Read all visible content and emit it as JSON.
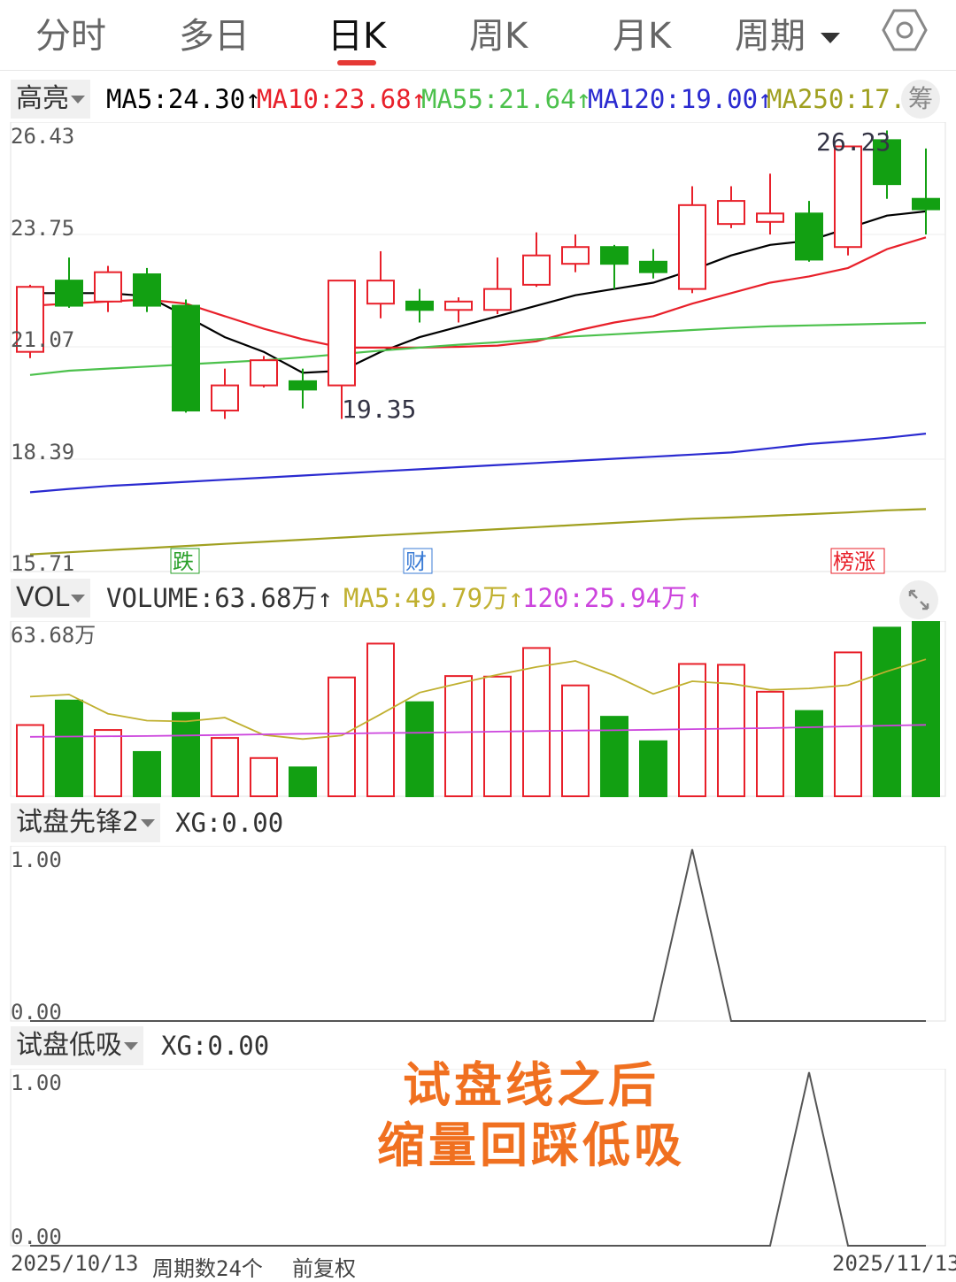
{
  "tabs": [
    {
      "label": "分时",
      "active": false
    },
    {
      "label": "多日",
      "active": false
    },
    {
      "label": "日K",
      "active": true
    },
    {
      "label": "周K",
      "active": false
    },
    {
      "label": "月K",
      "active": false
    },
    {
      "label": "周期",
      "active": false,
      "dropdown": true
    }
  ],
  "colors": {
    "up": "#e8202a",
    "down": "#12a012",
    "ma5": "#000000",
    "ma10": "#e8202a",
    "ma55": "#4cc14c",
    "ma120": "#2a2ad0",
    "ma250": "#a0a020",
    "vol_ma5": "#c0b030",
    "vol_ma120": "#cc44dd",
    "overlay": "#f07020"
  },
  "kline": {
    "selector": "高亮",
    "legend": {
      "ma5": "MA5:24.30↑",
      "ma10": "MA10:23.68↑",
      "ma55": "MA55:21.64↑",
      "ma120": "MA120:19.00↑",
      "ma250": "MA250:17."
    },
    "chip_button": "筹",
    "y_ticks": [
      "26.43",
      "23.75",
      "21.07",
      "18.39",
      "15.71"
    ],
    "high_label": "26.23",
    "low_label": "19.35",
    "tags": [
      "跌",
      "财",
      "榜涨"
    ]
  },
  "volume": {
    "selector": "VOL",
    "legend": {
      "volume": "VOLUME:63.68万↑",
      "ma5": "MA5:49.79万↑",
      "ma120": "120:25.94万↑"
    },
    "max_label": "63.68万"
  },
  "ind1": {
    "selector": "试盘先锋2",
    "value": "XG:0.00",
    "y_top": "1.00",
    "y_bottom": "0.00"
  },
  "ind2": {
    "selector": "试盘低吸",
    "value": "XG:0.00",
    "y_top": "1.00",
    "y_bottom": "0.00"
  },
  "overlay_text": {
    "line1": "试盘线之后",
    "line2": "缩量回踩低吸"
  },
  "footer": {
    "start_date": "2025/10/13",
    "periods": "周期数24个",
    "adjust": "前复权",
    "end_date": "2025/11/13"
  },
  "chart_data": [
    {
      "type": "candlestick",
      "title": "日K",
      "ylim": [
        15.71,
        26.43
      ],
      "candles": [
        {
          "open": 20.95,
          "close": 22.5,
          "high": 22.55,
          "low": 20.8
        },
        {
          "open": 22.65,
          "close": 22.05,
          "high": 23.2,
          "low": 22.0
        },
        {
          "open": 22.15,
          "close": 22.85,
          "high": 23.0,
          "low": 21.9
        },
        {
          "open": 22.8,
          "close": 22.05,
          "high": 22.95,
          "low": 21.9
        },
        {
          "open": 22.05,
          "close": 19.55,
          "high": 22.2,
          "low": 19.5
        },
        {
          "open": 19.55,
          "close": 20.15,
          "high": 20.55,
          "low": 19.35
        },
        {
          "open": 20.15,
          "close": 20.75,
          "high": 20.85,
          "low": 20.1
        },
        {
          "open": 20.25,
          "close": 20.05,
          "high": 20.55,
          "low": 19.6
        },
        {
          "open": 20.15,
          "close": 22.65,
          "high": 22.65,
          "low": 19.35
        },
        {
          "open": 22.1,
          "close": 22.65,
          "high": 23.35,
          "low": 21.75
        },
        {
          "open": 22.15,
          "close": 21.95,
          "high": 22.45,
          "low": 21.65
        },
        {
          "open": 21.95,
          "close": 22.15,
          "high": 22.25,
          "low": 21.65
        },
        {
          "open": 21.95,
          "close": 22.45,
          "high": 23.2,
          "low": 21.85
        },
        {
          "open": 22.55,
          "close": 23.25,
          "high": 23.8,
          "low": 22.5
        },
        {
          "open": 23.05,
          "close": 23.45,
          "high": 23.75,
          "low": 22.85
        },
        {
          "open": 23.45,
          "close": 23.05,
          "high": 23.5,
          "low": 22.45
        },
        {
          "open": 23.1,
          "close": 22.85,
          "high": 23.4,
          "low": 22.7
        },
        {
          "open": 22.45,
          "close": 24.45,
          "high": 24.9,
          "low": 22.35
        },
        {
          "open": 24.0,
          "close": 24.55,
          "high": 24.9,
          "low": 23.9
        },
        {
          "open": 24.05,
          "close": 24.25,
          "high": 25.2,
          "low": 23.75
        },
        {
          "open": 24.25,
          "close": 23.15,
          "high": 24.55,
          "low": 23.1
        },
        {
          "open": 23.45,
          "close": 25.85,
          "high": 25.85,
          "low": 23.25
        },
        {
          "open": 26.0,
          "close": 24.95,
          "high": 26.23,
          "low": 24.6
        },
        {
          "open": 24.6,
          "close": 24.35,
          "high": 25.8,
          "low": 23.75
        }
      ],
      "ma_lines": [
        {
          "name": "MA5",
          "values": [
            22.35,
            22.35,
            22.35,
            22.28,
            21.8,
            21.3,
            20.95,
            20.45,
            20.5,
            20.95,
            21.3,
            21.55,
            21.8,
            22.05,
            22.3,
            22.45,
            22.6,
            22.9,
            23.25,
            23.5,
            23.6,
            23.9,
            24.2,
            24.3
          ]
        },
        {
          "name": "MA10",
          "values": [
            22.05,
            22.1,
            22.15,
            22.2,
            22.1,
            21.8,
            21.5,
            21.25,
            21.05,
            21.05,
            21.05,
            21.07,
            21.1,
            21.2,
            21.45,
            21.65,
            21.8,
            22.1,
            22.35,
            22.6,
            22.75,
            22.95,
            23.4,
            23.68
          ]
        },
        {
          "name": "MA55",
          "values": [
            20.4,
            20.5,
            20.55,
            20.6,
            20.65,
            20.7,
            20.75,
            20.82,
            20.9,
            20.98,
            21.05,
            21.12,
            21.18,
            21.25,
            21.32,
            21.37,
            21.42,
            21.47,
            21.52,
            21.56,
            21.58,
            21.6,
            21.62,
            21.64
          ]
        },
        {
          "name": "MA120",
          "values": [
            17.6,
            17.68,
            17.75,
            17.8,
            17.85,
            17.9,
            17.95,
            18.0,
            18.05,
            18.1,
            18.15,
            18.2,
            18.25,
            18.3,
            18.35,
            18.4,
            18.45,
            18.5,
            18.55,
            18.65,
            18.75,
            18.82,
            18.9,
            19.0
          ]
        },
        {
          "name": "MA250",
          "values": [
            16.12,
            16.17,
            16.22,
            16.27,
            16.32,
            16.37,
            16.42,
            16.47,
            16.52,
            16.57,
            16.62,
            16.67,
            16.72,
            16.77,
            16.82,
            16.87,
            16.92,
            16.97,
            17.0,
            17.04,
            17.08,
            17.12,
            17.17,
            17.2
          ]
        }
      ],
      "annotations": [
        {
          "text": "26.23",
          "value": 26.23
        },
        {
          "text": "19.35",
          "value": 19.35
        }
      ]
    },
    {
      "type": "bar",
      "title": "VOL",
      "ylim": [
        0,
        63.68
      ],
      "values": [
        25.9,
        34.8,
        24.1,
        16.1,
        30.3,
        21.2,
        13.9,
        10.5,
        43.2,
        55.5,
        34.2,
        43.7,
        43.5,
        53.9,
        40.3,
        28.9,
        20.0,
        48.1,
        47.8,
        38.0,
        31.0,
        52.3,
        61.3,
        63.68
      ],
      "up": [
        true,
        false,
        true,
        false,
        false,
        true,
        true,
        false,
        true,
        true,
        false,
        true,
        true,
        true,
        true,
        false,
        false,
        true,
        true,
        true,
        false,
        true,
        false,
        false
      ],
      "ma_lines": [
        {
          "name": "MA5",
          "values": [
            36.2,
            37.0,
            30.0,
            27.5,
            27.2,
            28.6,
            22.3,
            20.8,
            22.1,
            29.8,
            37.7,
            41.0,
            44.2,
            47.0,
            49.2,
            43.9,
            37.2,
            41.8,
            40.9,
            38.7,
            39.2,
            40.4,
            45.4,
            49.79
          ]
        },
        {
          "name": "120",
          "values": [
            21.6,
            21.7,
            21.8,
            21.9,
            22.1,
            22.3,
            22.5,
            22.7,
            22.8,
            23.0,
            23.1,
            23.3,
            23.5,
            23.7,
            23.9,
            24.0,
            24.2,
            24.4,
            24.6,
            24.8,
            25.1,
            25.4,
            25.7,
            25.94
          ]
        }
      ]
    },
    {
      "type": "line",
      "title": "试盘先锋2",
      "ylim": [
        0,
        1
      ],
      "values": [
        0,
        0,
        0,
        0,
        0,
        0,
        0,
        0,
        0,
        0,
        0,
        0,
        0,
        0,
        0,
        0,
        0,
        1,
        0,
        0,
        0,
        0,
        0,
        0
      ]
    },
    {
      "type": "line",
      "title": "试盘低吸",
      "ylim": [
        0,
        1
      ],
      "values": [
        0,
        0,
        0,
        0,
        0,
        0,
        0,
        0,
        0,
        0,
        0,
        0,
        0,
        0,
        0,
        0,
        0,
        0,
        0,
        0,
        1,
        0,
        0,
        0
      ]
    }
  ]
}
